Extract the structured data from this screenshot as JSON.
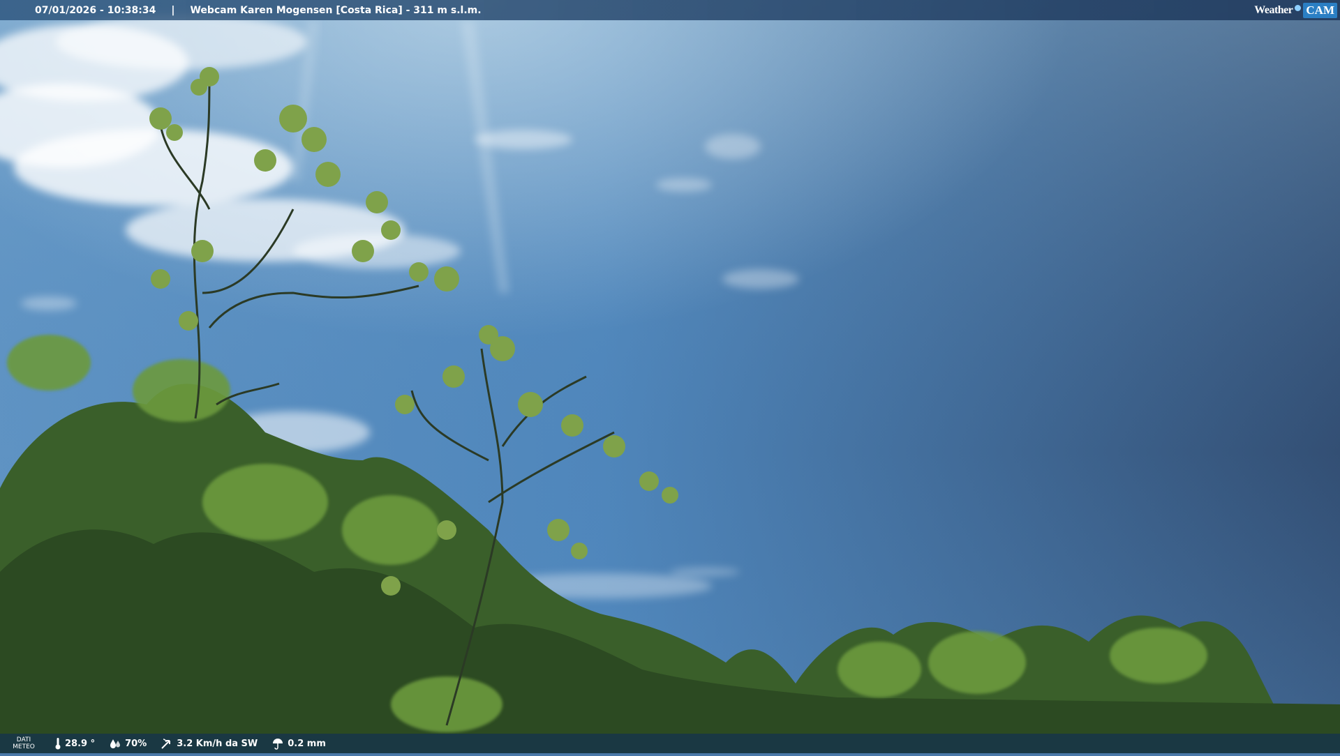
{
  "overlay": {
    "timestamp": "07/01/2026 - 10:38:34",
    "separator": "|",
    "title": "Webcam Karen Mogensen [Costa Rica] - 311 m s.l.m.",
    "logo": {
      "weather": "Weather",
      "cam": "CAM"
    }
  },
  "weather": {
    "label_line1": "DATI",
    "label_line2": "METEO",
    "temperature": "28.9 °",
    "humidity": "70%",
    "wind": "3.2 Km/h da SW",
    "rain": "0.2 mm"
  },
  "colors": {
    "sky_top": "#6f9ec6",
    "sky_right": "#3a5878",
    "foliage": "#3f6a2a",
    "bar": "#1c4a72"
  },
  "icons": [
    "thermometer-icon",
    "humidity-icon",
    "wind-icon",
    "rain-icon"
  ]
}
